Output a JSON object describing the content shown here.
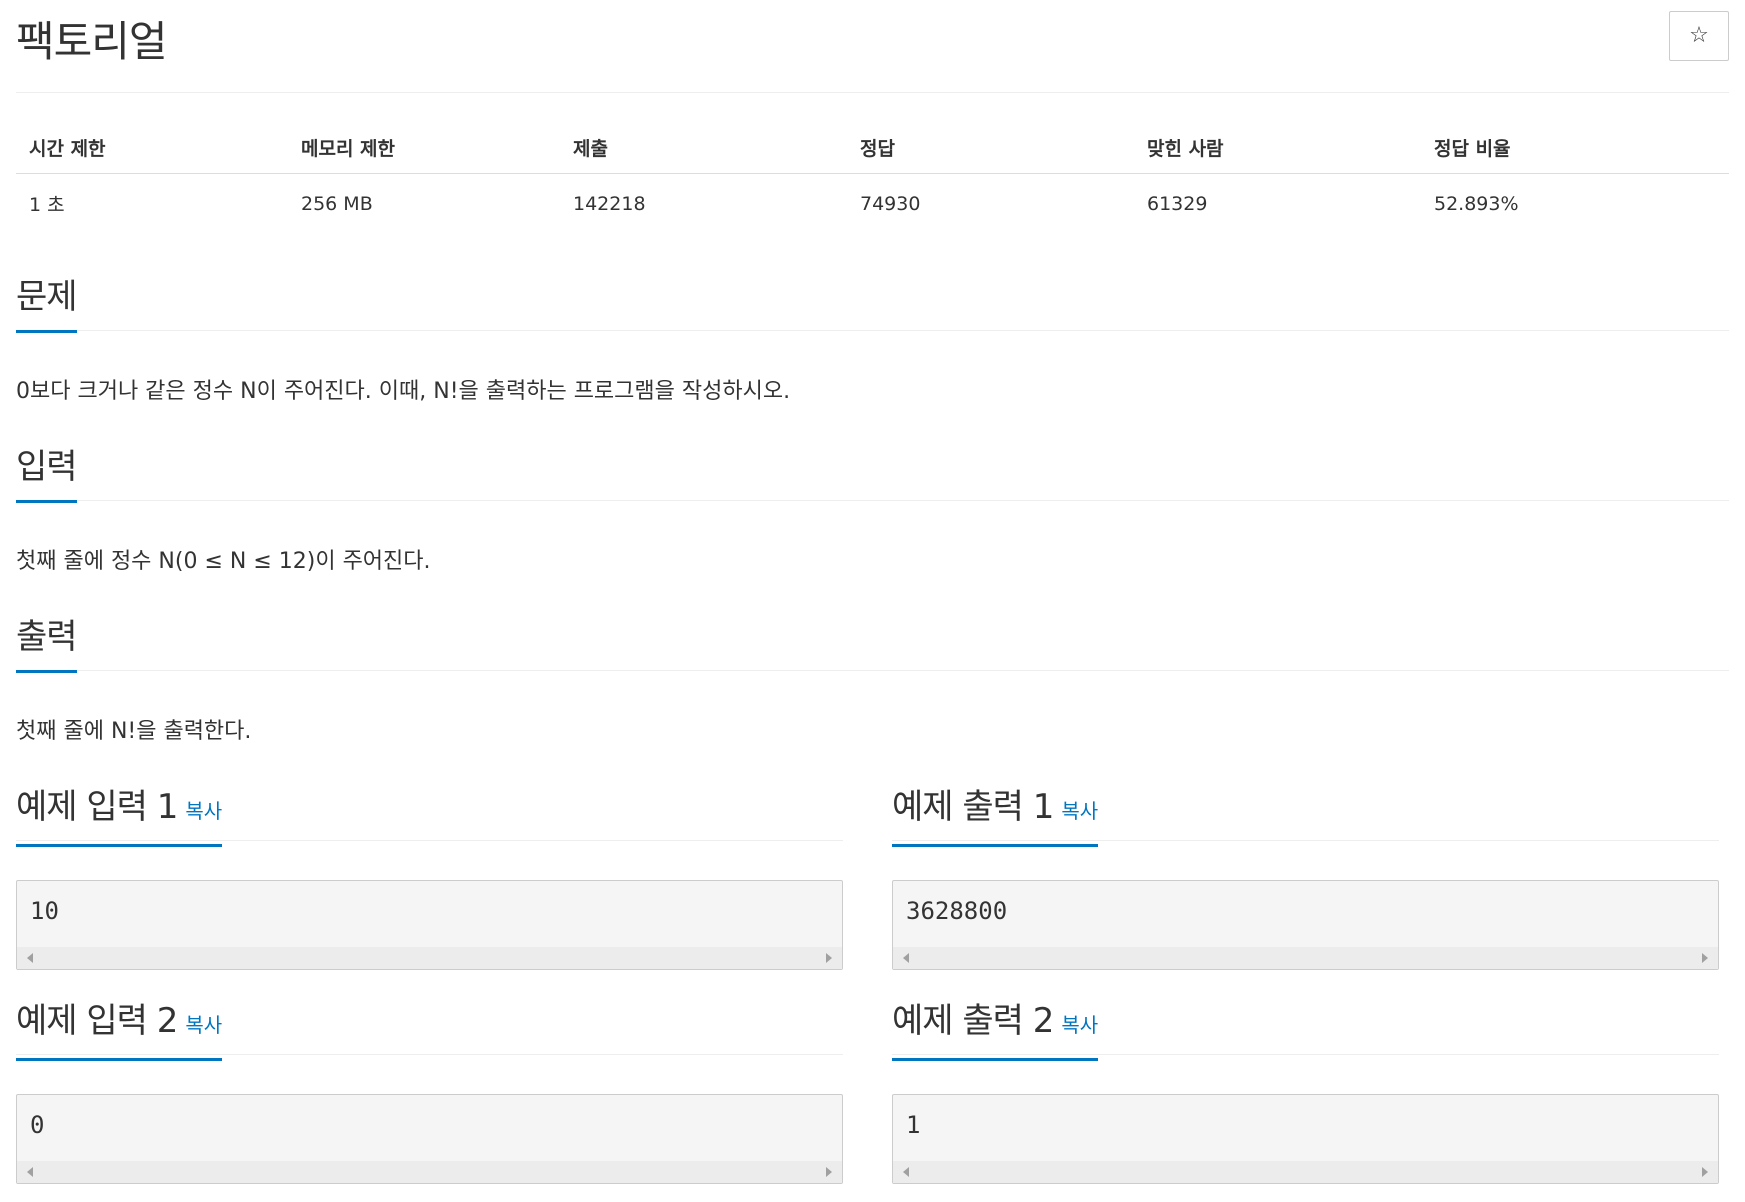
{
  "title": "팩토리얼",
  "star_icon": "☆",
  "info_table": {
    "headers": [
      "시간 제한",
      "메모리 제한",
      "제출",
      "정답",
      "맞힌 사람",
      "정답 비율"
    ],
    "values": [
      "1 초",
      "256 MB",
      "142218",
      "74930",
      "61329",
      "52.893%"
    ]
  },
  "problem": {
    "heading": "문제",
    "text": "0보다 크거나 같은 정수 N이 주어진다. 이때, N!을 출력하는 프로그램을 작성하시오."
  },
  "input": {
    "heading": "입력",
    "text": "첫째 줄에 정수 N(0 ≤ N ≤ 12)이 주어진다."
  },
  "output": {
    "heading": "출력",
    "text": "첫째 줄에 N!을 출력한다."
  },
  "copy_label": "복사",
  "samples": [
    {
      "input_heading": "예제 입력 1",
      "input_value": "10",
      "output_heading": "예제 출력 1",
      "output_value": "3628800"
    },
    {
      "input_heading": "예제 입력 2",
      "input_value": "0",
      "output_heading": "예제 출력 2",
      "output_value": "1"
    }
  ]
}
